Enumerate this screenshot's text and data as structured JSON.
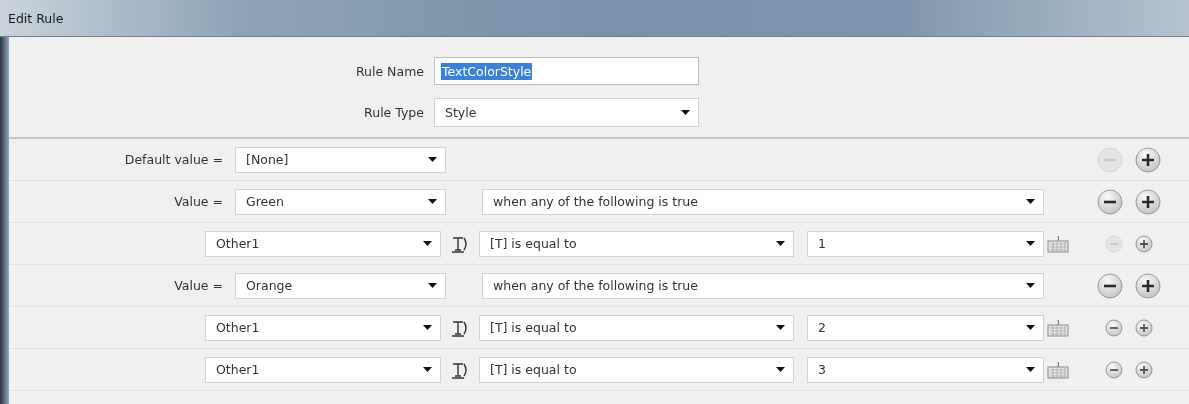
{
  "window": {
    "title": "Edit Rule"
  },
  "rule_name": {
    "label": "Rule Name",
    "value": "TextColorStyle",
    "text_selected": true
  },
  "rule_type": {
    "label": "Rule Type",
    "value": "Style"
  },
  "rows": [
    {
      "kind": "default",
      "label": "Default value =",
      "value": "[None]",
      "remove_disabled": true,
      "add_disabled": false
    },
    {
      "kind": "value",
      "label": "Value =",
      "value": "Green",
      "condition": "when any of the following is true",
      "remove_disabled": false,
      "add_disabled": false
    },
    {
      "kind": "condition",
      "field": "Other1",
      "operator": "[T] is equal to",
      "operand": "1",
      "remove_disabled": true,
      "add_disabled": false
    },
    {
      "kind": "value",
      "label": "Value =",
      "value": "Orange",
      "condition": "when any of the following is true",
      "remove_disabled": false,
      "add_disabled": false
    },
    {
      "kind": "condition",
      "field": "Other1",
      "operator": "[T] is equal to",
      "operand": "2",
      "remove_disabled": false,
      "add_disabled": false
    },
    {
      "kind": "condition",
      "field": "Other1",
      "operator": "[T] is equal to",
      "operand": "3",
      "remove_disabled": false,
      "add_disabled": false
    }
  ]
}
